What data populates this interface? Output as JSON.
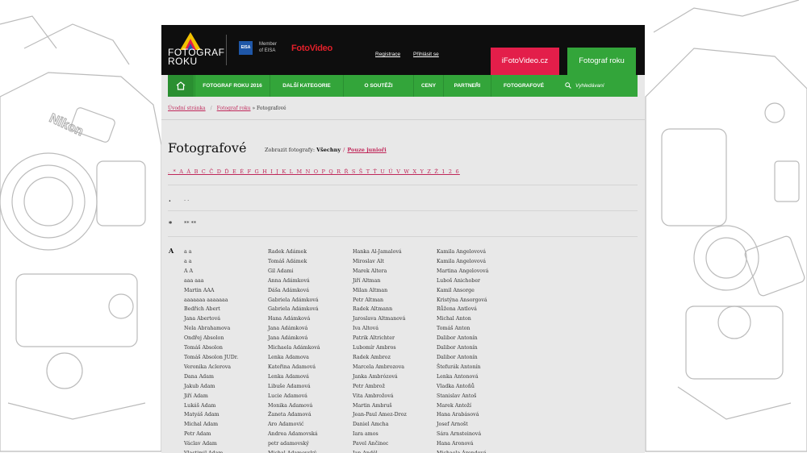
{
  "header": {
    "logo_line1": "FOTOGRAF",
    "logo_line2": "ROKU",
    "eisa_badge": "EISA",
    "eisa_text_line1": "Member",
    "eisa_text_line2": "of EISA",
    "partner": "FotoVideo",
    "register_link": "Registrace",
    "login_link": "Přihlásit se",
    "btn_ifotovideo": "iFotoVideo.cz",
    "btn_fotograf_roku": "Fotograf roku"
  },
  "nav": {
    "items": [
      "FOTOGRAF ROKU 2016",
      "DALŠÍ KATEGORIE",
      "O SOUTĚŽI",
      "CENY",
      "PARTNEŘI",
      "FOTOGRAFOVÉ"
    ],
    "search_placeholder": "Vyhledávaní"
  },
  "breadcrumb": {
    "home": "Úvodní stránka",
    "section": "Fotograf roku",
    "current": "» Fotografové"
  },
  "page": {
    "title": "Fotografové",
    "show_label": "Zobrazit fotografy:",
    "show_all": "Všechny",
    "show_sep": "/",
    "show_juniors": "Pouze junioři"
  },
  "alphabet": ". * A Á B C Č D Ď E É F G H I J K L M N O P Q R Ř S Š T Ť U Ú V W X Y Z Ž 1 2 6",
  "groups": [
    {
      "letter": ".",
      "value": ". ."
    },
    {
      "letter": "*",
      "value": "** **"
    },
    {
      "letter": "A",
      "value": ""
    }
  ],
  "columns": [
    [
      "a a",
      "a a",
      "A A",
      "aaa aaa",
      "Martin AAA",
      "aaaaaaa aaaaaaa",
      "Bedřich Abert",
      "Jana Abertová",
      "Nela Abrahamova",
      "Ondřej Absolon",
      "Tomáš Absolon",
      "Tomáš Absolon JUDr.",
      "Veronika Aclerova",
      "Dana Adam",
      "Jakub Adam",
      "Jiří Adam",
      "Lukáš Adam",
      "Matyáš Adam",
      "Michal Adam",
      "Petr Adam",
      "Václav Adam",
      "Vlastimil Adam"
    ],
    [
      "Radek Adámek",
      "Tomáš Adámek",
      "Gil Adami",
      "Anna Adámková",
      "Dáša Adámková",
      "Gabriela Adámková",
      "Gabriela Adámková",
      "Hana Adámková",
      "Jana Adámková",
      "Jana Adámková",
      "Michaela Adámková",
      "Lenka Adamova",
      "Kateřina Adamová",
      "Lenka Adamová",
      "Libuše Adamová",
      "Lucie Adamová",
      "Monika Adamová",
      "Žaneta Adamová",
      "Aro Adamović",
      "Andrea Adamovská",
      "petr adamovský",
      "Michal Adamovský"
    ],
    [
      "Hanka Al-Jamalová",
      "Miroslav Alt",
      "Marek Altera",
      "Jiří Altman",
      "Milan Altman",
      "Petr Altman",
      "Radek Altmann",
      "Jaroslava Altmanová",
      "Iva Altová",
      "Patrik Altrichter",
      "Lubomír Ambros",
      "Radek Ambroz",
      "Marcela Ambrozova",
      "Janka Ambrózová",
      "Petr Ambrož",
      "Vita Ambrožová",
      "Martin Ambruš",
      "Jean-Paul Amez-Droz",
      "Daniel Amcha",
      "Iara amos",
      "Pavel Ančinec",
      "Jan Anděl"
    ],
    [
      "Kamila Angelovová",
      "Kamila Angelovová",
      "Martina Angelovová",
      "Luboš Anichober",
      "Kamil Ansorge",
      "Kristýna Ansorgová",
      "Růžena Antlová",
      "Michal Anton",
      "Tomáš Anton",
      "Dalibor Antonín",
      "Dalibor Antonín",
      "Dalibor Antonín",
      "Štefurák Antonín",
      "Lenka Antonová",
      "Vladka Antoňů",
      "Stanislav Antoš",
      "Marek Antoží",
      "Hana Arabásová",
      "Josef Arnošt",
      "Sára Arnsteinová",
      "Hana Aronová",
      "Michaela Árendová"
    ]
  ],
  "colors": {
    "topbar": "#0e0e0e",
    "green": "#33a53a",
    "pink": "#e31e4a",
    "link": "#c0285a"
  }
}
